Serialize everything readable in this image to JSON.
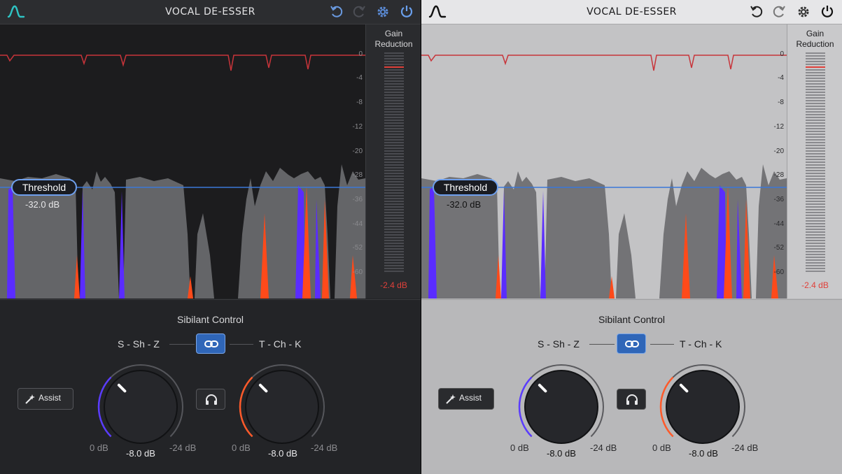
{
  "app": {
    "title": "VOCAL DE-ESSER"
  },
  "icons": {
    "logo": "waveform-logo-icon",
    "undo": "undo-icon",
    "redo": "redo-icon",
    "settings": "gear-icon",
    "power": "power-icon",
    "link": "link-icon",
    "listen": "headphones-icon",
    "assist": "magic-wand-icon"
  },
  "display": {
    "threshold_label": "Threshold",
    "threshold_value": "-32.0 dB",
    "scale": [
      "0",
      "-4",
      "-8",
      "-12",
      "-20",
      "-28",
      "-36",
      "-44",
      "-52",
      "-60"
    ]
  },
  "meter": {
    "title_line1": "Gain",
    "title_line2": "Reduction",
    "value": "-2.4 dB"
  },
  "controls": {
    "section_title": "Sibilant Control",
    "assist_label": "Assist",
    "left_band": {
      "label": "S - Sh - Z",
      "min": "0 dB",
      "max": "-24 dB",
      "value": "-8.0 dB",
      "level": 0.333,
      "accent": "#5a3cff"
    },
    "right_band": {
      "label": "T - Ch - K",
      "min": "0 dB",
      "max": "-24 dB",
      "value": "-8.0 dB",
      "level": 0.333,
      "accent": "#ff5a2a"
    }
  },
  "colors": {
    "threshold_line": "#3b78d8",
    "detector_curve": "#c8343a",
    "sibilant_s": "#5a2cff",
    "sibilant_t": "#ff4a1a",
    "gain_reduction": "#e0403a"
  }
}
